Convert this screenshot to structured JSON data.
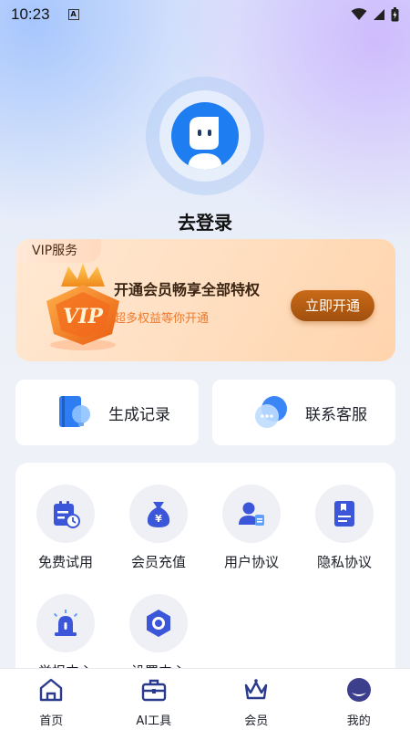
{
  "status_bar": {
    "time": "10:23",
    "indicator": "A"
  },
  "profile": {
    "login_text": "去登录"
  },
  "vip": {
    "tag": "VIP服务",
    "badge_text": "VIP",
    "title": "开通会员畅享全部特权",
    "subtitle": "超多权益等你开通",
    "button": "立即开通"
  },
  "quick_actions": [
    {
      "label": "生成记录",
      "icon": "record-book-icon"
    },
    {
      "label": "联系客服",
      "icon": "chat-bubble-icon"
    }
  ],
  "grid": [
    {
      "label": "免费试用",
      "icon": "trial-icon"
    },
    {
      "label": "会员充值",
      "icon": "money-bag-icon"
    },
    {
      "label": "用户协议",
      "icon": "user-agreement-icon"
    },
    {
      "label": "隐私协议",
      "icon": "privacy-doc-icon"
    },
    {
      "label": "举报中心",
      "icon": "alarm-icon"
    },
    {
      "label": "设置中心",
      "icon": "settings-hex-icon"
    }
  ],
  "bottom_nav": [
    {
      "label": "首页",
      "icon": "home-icon"
    },
    {
      "label": "AI工具",
      "icon": "toolbox-icon"
    },
    {
      "label": "会员",
      "icon": "crown-icon"
    },
    {
      "label": "我的",
      "icon": "profile-icon",
      "active": true
    }
  ],
  "colors": {
    "accent_blue": "#1e7df0",
    "vip_button": "#b25c12",
    "vip_subtitle": "#ef7a2e",
    "page_background": "#eef1f7"
  }
}
